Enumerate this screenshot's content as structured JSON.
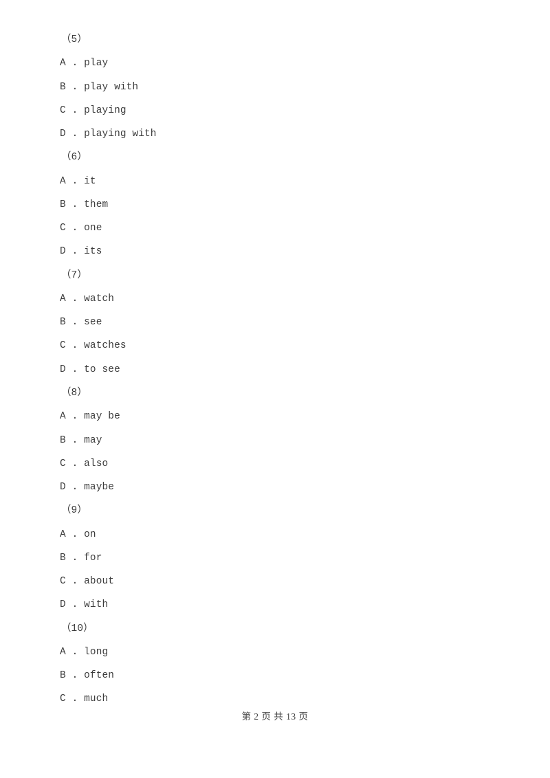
{
  "document": {
    "page_background": "#ffffff",
    "text_color": "#3b3b3b"
  },
  "questions": [
    {
      "number": "（5）",
      "options": [
        "A . play",
        "B . play with",
        "C . playing",
        "D . playing with"
      ]
    },
    {
      "number": "（6）",
      "options": [
        "A . it",
        "B . them",
        "C . one",
        "D . its"
      ]
    },
    {
      "number": "（7）",
      "options": [
        "A . watch",
        "B . see",
        "C . watches",
        "D . to see"
      ]
    },
    {
      "number": "（8）",
      "options": [
        "A . may be",
        "B . may",
        "C . also",
        "D . maybe"
      ]
    },
    {
      "number": "（9）",
      "options": [
        "A . on",
        "B . for",
        "C . about",
        "D . with"
      ]
    },
    {
      "number": "（10）",
      "options": [
        "A . long",
        "B . often",
        "C . much"
      ]
    }
  ],
  "footer": {
    "text": "第 2 页 共 13 页",
    "current_page": "2",
    "total_pages": "13"
  }
}
